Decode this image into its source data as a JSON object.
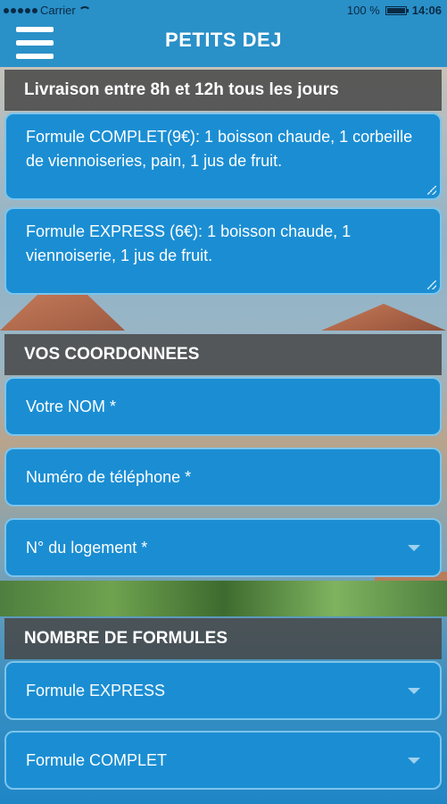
{
  "status_bar": {
    "carrier": "Carrier",
    "battery_percent": "100 %",
    "time": "14:06"
  },
  "header": {
    "title": "PETITS DEJ",
    "menu_icon": "hamburger-menu-icon"
  },
  "delivery_notice": "Livraison entre 8h et 12h tous les jours",
  "formulas": [
    {
      "text": "Formule COMPLET(9€): 1 boisson chaude, 1 corbeille de viennoiseries, pain, 1 jus de fruit."
    },
    {
      "text": "Formule EXPRESS (6€): 1 boisson chaude, 1 viennoiserie, 1 jus de fruit."
    }
  ],
  "contact_section": {
    "title": "VOS COORDONNEES",
    "name_placeholder": "Votre NOM *",
    "phone_placeholder": "Numéro de téléphone *",
    "lodging_placeholder": "N° du logement *"
  },
  "quantity_section": {
    "title": "NOMBRE DE FORMULES",
    "express_label": "Formule EXPRESS",
    "complet_label": "Formule COMPLET"
  },
  "colors": {
    "accent_blue": "#1b8ed3",
    "header_blue": "#2a90c8",
    "section_gray": "#464646"
  }
}
